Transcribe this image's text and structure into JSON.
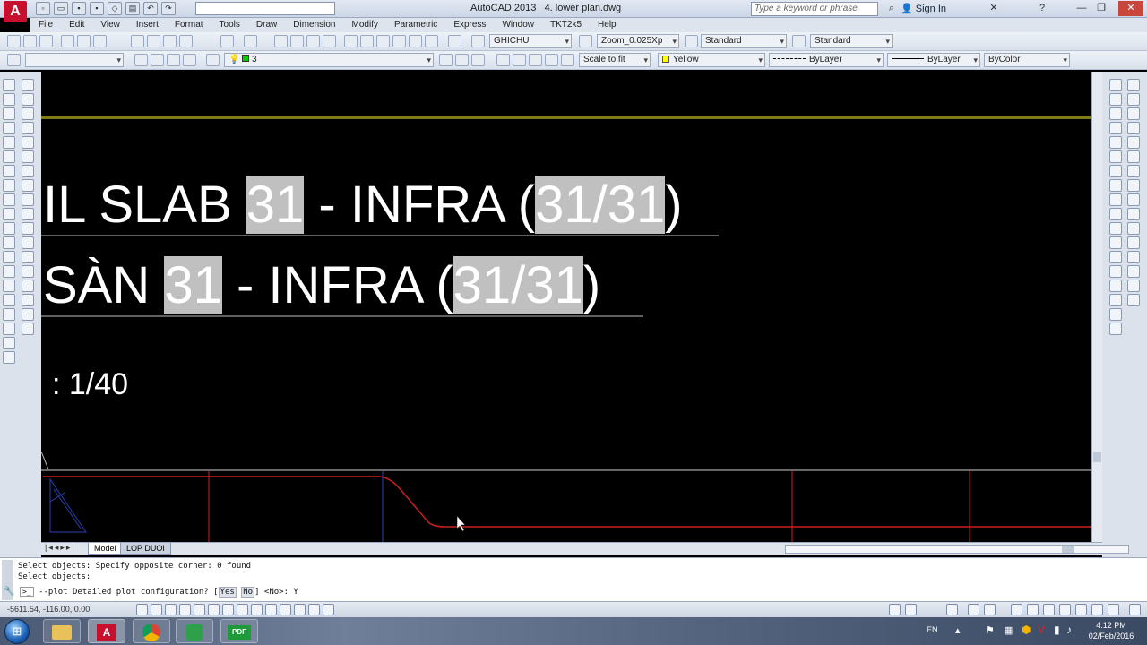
{
  "titlebar": {
    "app_logo": "A",
    "app_name": "AutoCAD 2013",
    "document": "4. lower plan.dwg",
    "search_placeholder": "Type a keyword or phrase",
    "sign_in": "Sign In",
    "close": "✕",
    "help": "?",
    "minimize": "—",
    "restore": "❐",
    "close_window": "✕"
  },
  "menu": [
    "File",
    "Edit",
    "View",
    "Insert",
    "Format",
    "Tools",
    "Draw",
    "Dimension",
    "Modify",
    "Parametric",
    "Express",
    "Window",
    "TKT2k5",
    "Help"
  ],
  "toolbar1": {
    "text_style": "GHICHU",
    "dim_style": "Zoom_0.025Xp",
    "table_style": "Standard",
    "multileader_style": "Standard"
  },
  "toolbar2": {
    "layer_value": "3",
    "scale": "Scale to fit",
    "color": "Yellow",
    "linetype": "ByLayer",
    "lineweight": "ByLayer",
    "plotstyle": "ByColor"
  },
  "canvas": {
    "line1_a": "IL SLAB ",
    "line1_hl1": "31",
    "line1_b": " - INFRA (",
    "line1_hl2": "31",
    "line1_slash": "/",
    "line1_hl3": "31",
    "line1_c": ")",
    "line2_a": " SÀN ",
    "line2_hl1": "31",
    "line2_b": " - INFRA (",
    "line2_hl2": "31",
    "line2_slash": "/",
    "line2_hl3": "31",
    "line2_c": ")",
    "scale_text": ": 1/40",
    "colors": {
      "olive_line": "#7d7a1a",
      "red_line": "#cc1f1f",
      "blue_line": "#2b3fb3",
      "highlight": "#c0c0c0"
    }
  },
  "tabs": {
    "model": "Model",
    "layout": "LOP DUOI"
  },
  "command": {
    "history1": "Select objects: Specify opposite corner: 0 found",
    "history2": "Select objects:",
    "prompt_prefix": "--plot Detailed plot configuration? [",
    "opt_yes": "Yes",
    "opt_no": "No",
    "prompt_suffix": "] <No>: Y"
  },
  "status": {
    "coords": "-5611.54, -116.00, 0.00"
  },
  "taskbar": {
    "lang": "EN",
    "time": "4:12 PM",
    "date": "02/Feb/2016",
    "pdf_label": "PDF",
    "acad_label": "A",
    "start": "⊞"
  }
}
